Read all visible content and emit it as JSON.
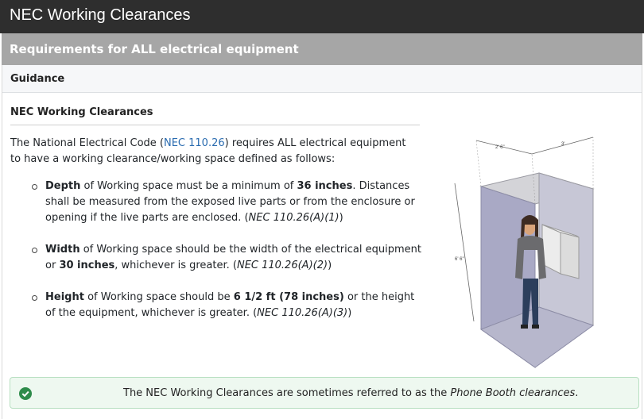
{
  "header": {
    "title": "NEC Working Clearances"
  },
  "subheader": {
    "title": "Requirements for ALL electrical equipment"
  },
  "guidance": {
    "label": "Guidance"
  },
  "section": {
    "title": "NEC Working Clearances",
    "intro_pre": "The National Electrical Code (",
    "intro_link": "NEC 110.26",
    "intro_post": ") requires ALL electrical equipment to have a working clearance/working space defined as follows:"
  },
  "requirements": [
    {
      "term": "Depth",
      "text_pre": " of Working space must be a minimum of ",
      "strong": "36 inches",
      "text_post": ". Distances shall be measured from the exposed live parts or from the enclosure or opening if the live parts are enclosed. (",
      "cite": "NEC 110.26(A)(1)",
      "close": ")"
    },
    {
      "term": "Width",
      "text_pre": " of Working space should be the width of the electrical equipment or ",
      "strong": "30 inches",
      "text_post": ", whichever is greater. (",
      "cite": "NEC 110.26(A)(2)",
      "close": ")"
    },
    {
      "term": "Height",
      "text_pre": " of Working space should be ",
      "strong": "6 1/2 ft (78 inches)",
      "text_post": " or the height of the equipment, whichever is greater. (",
      "cite": "NEC 110.26(A)(3)",
      "close": ")"
    }
  ],
  "figure": {
    "dim_width": "2' 6\"",
    "dim_depth": "3'",
    "dim_height": "6' 6\""
  },
  "callout": {
    "text_pre": "The NEC Working Clearances are sometimes referred to as the ",
    "text_em": "Phone Booth clearances",
    "text_post": "."
  }
}
